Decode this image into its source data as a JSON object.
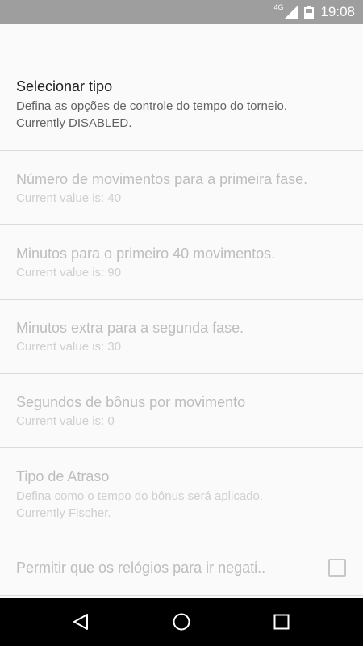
{
  "status_bar": {
    "network_type": "4G",
    "time": "19:08",
    "icons": [
      "signal-icon",
      "battery-icon"
    ]
  },
  "preferences": [
    {
      "title": "Selecionar tipo",
      "summary_line1": "Defina as opções de controle do tempo do torneio.",
      "summary_line2": "Currently DISABLED.",
      "enabled": true
    },
    {
      "title": "Número de movimentos para a primeira fase.",
      "summary": "Current value is: 40",
      "enabled": false
    },
    {
      "title": "Minutos para o primeiro 40 movimentos.",
      "summary": "Current value is: 90",
      "enabled": false
    },
    {
      "title": "Minutos extra para a segunda fase.",
      "summary": "Current value is: 30",
      "enabled": false
    },
    {
      "title": "Segundos de bônus por movimento",
      "summary": "Current value is: 0",
      "enabled": false
    },
    {
      "title": "Tipo de Atraso",
      "summary_line1": "Defina como o tempo do bônus será aplicado.",
      "summary_line2": "Currently Fischer.",
      "enabled": false
    },
    {
      "title": "Permitir que os relógios para ir negati..",
      "checked": false,
      "enabled": false
    }
  ],
  "nav_bar": {
    "buttons": [
      "back-icon",
      "home-icon",
      "recent-apps-icon"
    ]
  }
}
